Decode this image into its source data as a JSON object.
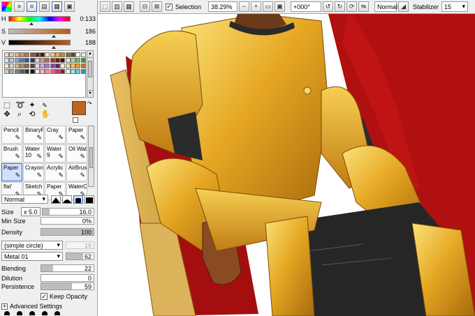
{
  "toolbar": {
    "selection_label": "Selection",
    "selection_checked": true,
    "zoom": "38.29%",
    "rotation": "+000°",
    "blend_mode": "Normal",
    "stabilizer_label": "Stabilizer",
    "stabilizer_value": "15"
  },
  "color": {
    "h_label": "H",
    "h_value": "0:133",
    "s_label": "S",
    "s_value": "186",
    "v_label": "V",
    "v_value": "188",
    "h_fraction": 0.37,
    "s_fraction": 0.73,
    "v_fraction": 0.74,
    "primary": "#c0641e",
    "secondary": "#f0b49a"
  },
  "tools": [
    {
      "label": "Pencil",
      "icon": "pencil-icon"
    },
    {
      "label": "BinaryPe",
      "icon": "pen-icon"
    },
    {
      "label": "Cray",
      "icon": "crayon-icon"
    },
    {
      "label": "Paper",
      "icon": "paper-icon"
    },
    {
      "label": "Brush",
      "icon": "brush-icon"
    },
    {
      "label": "Water",
      "sub": "10",
      "icon": "water-icon"
    },
    {
      "label": "Water",
      "sub": "9",
      "icon": "water-icon"
    },
    {
      "label": "Oil Water",
      "icon": "oil-icon"
    },
    {
      "label": "Paper",
      "icon": "paper-icon",
      "selected": true
    },
    {
      "label": "Crayon",
      "icon": "crayon-icon"
    },
    {
      "label": "Acrylic",
      "icon": "acrylic-icon"
    },
    {
      "label": "AirBrush",
      "icon": "airbrush-icon"
    },
    {
      "label": "flat'",
      "icon": "flat-icon"
    },
    {
      "label": "Sketch B",
      "icon": "sketch-icon"
    },
    {
      "label": "Paper",
      "icon": "paper-icon"
    },
    {
      "label": "WaterCo",
      "icon": "water-icon"
    }
  ],
  "brush": {
    "mode": "Normal",
    "size_label": "Size",
    "size_mult": "x 5.0",
    "size_value": "16.0",
    "min_size_label": "Min Size",
    "min_size_value": "0%",
    "density_label": "Density",
    "density_value": "100",
    "shape": "(simple circle)",
    "shape_value": "16",
    "texture": "Metal 01",
    "texture_value": "62",
    "blending_label": "Blending",
    "blending_value": "22",
    "dilution_label": "Dilution",
    "dilution_value": "0",
    "persistence_label": "Persistence",
    "persistence_value": "59",
    "keep_opacity_label": "Keep Opacity",
    "advanced_label": "Advanced Settings"
  }
}
